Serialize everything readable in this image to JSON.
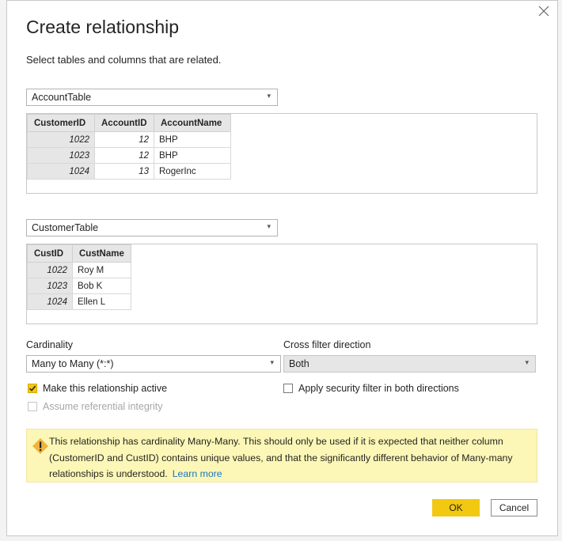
{
  "dialog": {
    "title": "Create relationship",
    "subtitle": "Select tables and columns that are related."
  },
  "table1": {
    "selected": "AccountTable",
    "columns": [
      "CustomerID",
      "AccountID",
      "AccountName"
    ],
    "rows": [
      [
        "1022",
        "12",
        "BHP"
      ],
      [
        "1023",
        "12",
        "BHP"
      ],
      [
        "1024",
        "13",
        "RogerInc"
      ]
    ]
  },
  "table2": {
    "selected": "CustomerTable",
    "columns": [
      "CustID",
      "CustName"
    ],
    "rows": [
      [
        "1022",
        "Roy M"
      ],
      [
        "1023",
        "Bob K"
      ],
      [
        "1024",
        "Ellen L"
      ]
    ]
  },
  "cardinality": {
    "label": "Cardinality",
    "value": "Many to Many (*:*)"
  },
  "cross_filter": {
    "label": "Cross filter direction",
    "value": "Both"
  },
  "options": {
    "active_label": "Make this relationship active",
    "active_checked": true,
    "referential_label": "Assume referential integrity",
    "referential_checked": false,
    "security_label": "Apply security filter in both directions",
    "security_checked": false
  },
  "warning": {
    "text": "This relationship has cardinality Many-Many. This should only be used if it is expected that neither column (CustomerID and CustID) contains unique values, and that the significantly different behavior of Many-many relationships is understood.",
    "link": "Learn more"
  },
  "buttons": {
    "ok": "OK",
    "cancel": "Cancel"
  },
  "icons": {
    "caret": "▾",
    "close": "close-icon",
    "warning": "warning-icon"
  },
  "colors": {
    "accent": "#f2c811",
    "warning_bg": "#fcf7b6",
    "link": "#1a73c9"
  }
}
